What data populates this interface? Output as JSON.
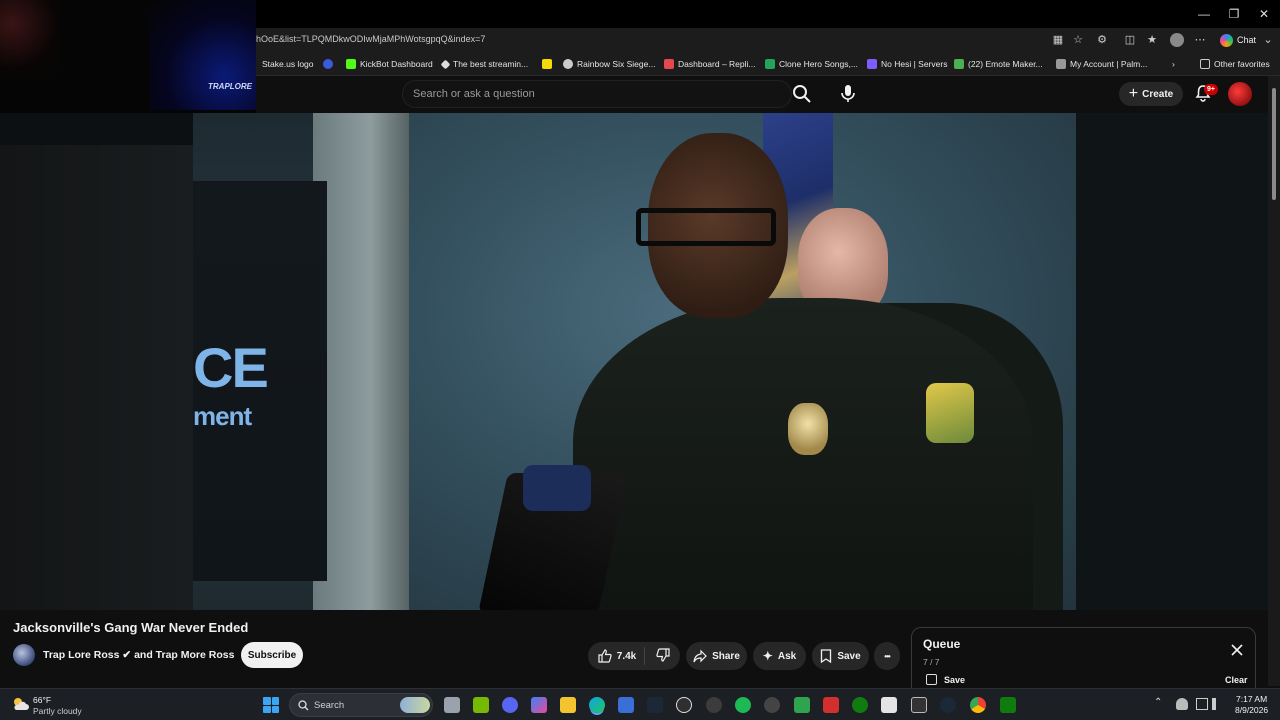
{
  "browser": {
    "url_visible": "hOoE&list=TLPQMDkwODIwMjaMPhWotsgpqQ&index=7",
    "chat_label": "Chat",
    "bookmarks": [
      {
        "label": "Stake.us logo",
        "color": "#1c1c1c"
      },
      {
        "label": "",
        "color": "#3b5bdb"
      },
      {
        "label": "KickBot Dashboard",
        "color": "#53fc18"
      },
      {
        "label": "The best streamin...",
        "color": "#dddddd"
      },
      {
        "label": "",
        "color": "#f5d90a"
      },
      {
        "label": "Rainbow Six Siege...",
        "color": "#cccccc"
      },
      {
        "label": "Dashboard – Repli...",
        "color": "#e5484d"
      },
      {
        "label": "Clone Hero Songs,...",
        "color": "#22a559"
      },
      {
        "label": "No Hesi | Servers",
        "color": "#7c5cff"
      },
      {
        "label": "(22) Emote Maker...",
        "color": "#4caf50"
      },
      {
        "label": "My Account | Palm...",
        "color": "#999999"
      }
    ],
    "other_favorites": "Other favorites"
  },
  "overlay": {
    "logo_text": "TRAPLORE"
  },
  "youtube": {
    "search_placeholder": "Search or ask a question",
    "create_label": "Create",
    "notif_count": "9+"
  },
  "video_frame": {
    "panel_big": "CE",
    "panel_small": "ment"
  },
  "video": {
    "title": "Jacksonville's Gang War Never Ended",
    "channel": "Trap Lore Ross ✔ and Trap More Ross",
    "subscribe_label": "Subscribe",
    "likes": "7.4k",
    "share_label": "Share",
    "ask_label": "Ask",
    "save_label": "Save",
    "more_label": "•••"
  },
  "queue": {
    "title": "Queue",
    "count": "7 / 7",
    "save_label": "Save",
    "clear_label": "Clear"
  },
  "taskbar": {
    "temp": "66°F",
    "weather": "Partly cloudy",
    "search_label": "Search",
    "time": "7:17 AM",
    "date": "8/9/2026"
  },
  "colors": {
    "accent_red": "#cc0000",
    "pill_bg": "#272727"
  }
}
